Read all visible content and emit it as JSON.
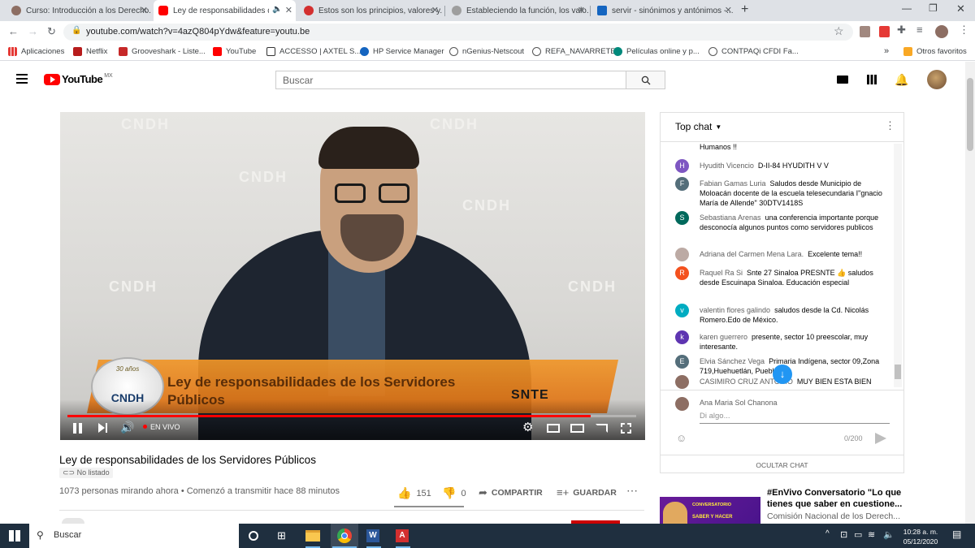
{
  "browser": {
    "tabs": [
      {
        "title": "Curso: Introducción a los Derecho...",
        "favicon_color": "#8d6e63"
      },
      {
        "title": "Ley de responsabilidades de los...",
        "favicon_color": "#ff0000"
      },
      {
        "title": "Estos son los principios, valores y...",
        "favicon_color": "#d32f2f"
      },
      {
        "title": "Estableciendo la función, los valo...",
        "favicon_color": "#9e9e9e"
      },
      {
        "title": "servir - sinónimos y antónimos -...",
        "favicon_color": "#1565c0"
      }
    ],
    "url": "youtube.com/watch?v=4azQ804pYdw&feature=youtu.be",
    "bookmarks": [
      {
        "label": "Aplicaciones",
        "color": "#e53935"
      },
      {
        "label": "Netflix",
        "color": "#b71c1c"
      },
      {
        "label": "Grooveshark - Liste...",
        "color": "#c62828"
      },
      {
        "label": "YouTube",
        "color": "#ff0000"
      },
      {
        "label": "ACCESSO | AXTEL S...",
        "color": "#333333"
      },
      {
        "label": "HP Service Manager",
        "color": "#1565c0"
      },
      {
        "label": "nGenius-Netscout",
        "color": "#555555"
      },
      {
        "label": "REFA_NAVARRETE",
        "color": "#555555"
      },
      {
        "label": "Películas online y p...",
        "color": "#00897b"
      },
      {
        "label": "CONTPAQi CFDI Fa...",
        "color": "#555555"
      }
    ],
    "other_bookmarks": "Otros favoritos",
    "more_bookmarks": "»"
  },
  "youtube": {
    "logo_text": "YouTube",
    "region": "MX",
    "search_placeholder": "Buscar"
  },
  "video": {
    "overlay_title_line1": "Ley de responsabilidades de los Servidores",
    "overlay_title_line2": "Públicos",
    "channel_badge_small": "30 años",
    "channel_badge": "CNDH",
    "watermark": "CNDH",
    "live_label": "EN VIVO",
    "progress": 0.92,
    "corner_text": "SNTE"
  },
  "info": {
    "title": "Ley de responsabilidades de los Servidores Públicos",
    "unlisted": "No listado",
    "meta": "1073 personas mirando ahora • Comenzó a transmitir hace 88 minutos",
    "likes": "151",
    "dislikes": "0",
    "share": "COMPARTIR",
    "save": "GUARDAR"
  },
  "chat": {
    "header": "Top chat",
    "top_fragment": "Humanos !!",
    "messages": [
      {
        "author": "Hyudith Vicencio",
        "text": "D-II-84 HYUDITH V V",
        "initial": "H",
        "color": "#7e57c2"
      },
      {
        "author": "Fabian Gamas Luria",
        "text": "Saludos desde Municipio de Moloacán docente de la escuela telesecundaria I\"gnacio María de Allende\" 30DTV1418S",
        "initial": "F",
        "color": "#546e7a"
      },
      {
        "author": "Sebastiana Arenas",
        "text": "una conferencia importante porque desconocía algunos puntos como servidores publicos",
        "initial": "S",
        "color": "#00695c"
      },
      {
        "author": "Adriana del Carmen Mena Lara.",
        "text": "Excelente tema!!",
        "initial": "",
        "color": "#bcaaa4"
      },
      {
        "author": "Raquel Ra Si",
        "text": "Snte 27 Sinaloa PRESNTE 👍 saludos desde Escuinapa Sinaloa. Educación especial",
        "initial": "R",
        "color": "#f4511e"
      },
      {
        "author": "valentin flores galindo",
        "text": "saludos desde la Cd. Nicolás Romero.Edo de México.",
        "initial": "v",
        "color": "#00acc1"
      },
      {
        "author": "karen guerrero",
        "text": "presente, sector 10 preescolar, muy interesante.",
        "initial": "k",
        "color": "#5e35b1"
      },
      {
        "author": "Elvia Sánchez Vega",
        "text": "Primaria Indígena, sector 09,Zona 719,Huehuetlán, Puebla.",
        "initial": "E",
        "color": "#546e7a"
      },
      {
        "author": "CASIMIRO CRUZ ANTONIO",
        "text": "MUY BIEN ESTA BIEN",
        "initial": "",
        "color": "#8d6e63"
      }
    ],
    "input_author": "Ana Maria Sol Chanona",
    "input_placeholder": "Di algo...",
    "counter": "0/200",
    "hide_chat": "OCULTAR CHAT"
  },
  "recommendation": {
    "title_line1": "#EnVivo Conversatorio \"Lo que",
    "title_line2": "tienes que saber en cuestione...",
    "channel": "Comisión Nacional de los Derech...",
    "thumb_line1": "CONVERSATORIO",
    "thumb_line2": "SABER Y HACER"
  },
  "taskbar": {
    "search_placeholder": "Buscar",
    "time": "10:28 a. m.",
    "date": "05/12/2020"
  }
}
